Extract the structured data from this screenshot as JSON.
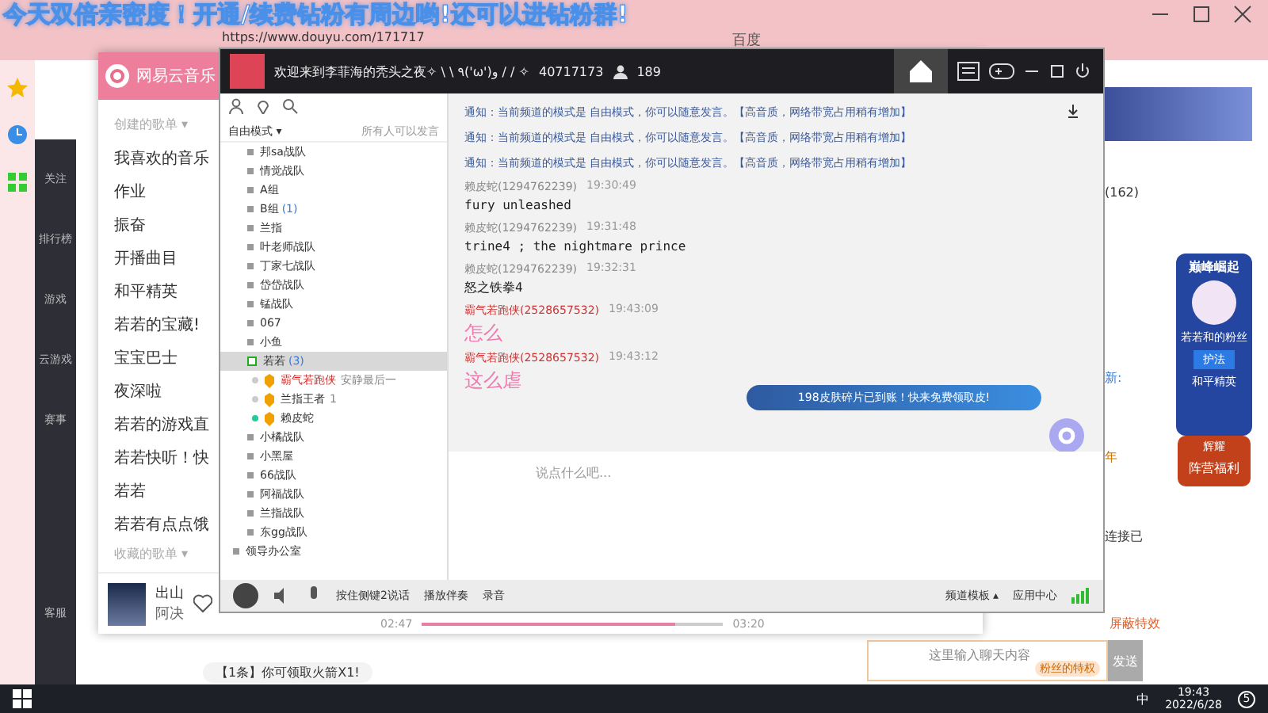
{
  "overlay_banner": "今天双倍亲密度！开通/续费钻粉有周边哟!还可以进钻粉群!",
  "browser": {
    "address": "https://www.douyu.com/171717",
    "bookmark": "百度"
  },
  "site_nav": [
    {
      "label": "关注"
    },
    {
      "label": "排行榜"
    },
    {
      "label": "游戏"
    },
    {
      "label": "云游戏"
    },
    {
      "label": "赛事"
    }
  ],
  "site_service": "客服",
  "music": {
    "title": "网易云音乐",
    "created_header": "创建的歌单 ▾",
    "playlists": [
      "我喜欢的音乐",
      "作业",
      "振奋",
      "开播曲目",
      "和平精英",
      "若若的宝藏!",
      "宝宝巴士",
      "夜深啦",
      "若若的游戏直",
      "若若快听！快",
      "若若",
      "若若有点点饿"
    ],
    "collected_header": "收藏的歌单 ▾",
    "song": "出山",
    "artist": "阿决",
    "elapsed": "02:47",
    "total": "03:20",
    "progress": {
      "level": 0.84
    }
  },
  "yy": {
    "title": "欢迎来到李菲海的秃头之夜✧ \\ \\ ٩('ω')و / / ✧",
    "channel_id": "40717173",
    "online": "189",
    "mode": "自由模式 ▾",
    "mode_hint": "所有人可以发言",
    "tree": [
      {
        "kind": "channel",
        "label": "邦sa战队",
        "selected": false
      },
      {
        "kind": "channel",
        "label": "情觉战队",
        "selected": false
      },
      {
        "kind": "channel",
        "label": "A组",
        "selected": false
      },
      {
        "kind": "channel",
        "label": "B组",
        "count": "(1)",
        "selected": false
      },
      {
        "kind": "channel",
        "label": "兰指",
        "selected": false
      },
      {
        "kind": "channel",
        "label": "叶老师战队",
        "selected": false
      },
      {
        "kind": "channel",
        "label": "丁家七战队",
        "selected": false
      },
      {
        "kind": "channel",
        "label": "岱岱战队",
        "selected": false
      },
      {
        "kind": "channel",
        "label": "锰战队",
        "selected": false
      },
      {
        "kind": "channel",
        "label": "067",
        "selected": false
      },
      {
        "kind": "channel",
        "label": "小鱼",
        "selected": false
      },
      {
        "kind": "channel",
        "label": "若若",
        "count": "(3)",
        "selected": true,
        "children": [
          {
            "kind": "member",
            "label": "霸气若跑侠",
            "note": "安静最后一",
            "color": "#d0312d",
            "active": false
          },
          {
            "kind": "member",
            "label": "兰指王者",
            "note": "1",
            "color": "#333333",
            "active": false
          },
          {
            "kind": "member",
            "label": "赖皮蛇",
            "color": "#333333",
            "active": true
          }
        ]
      },
      {
        "kind": "channel",
        "label": "小橘战队",
        "selected": false
      },
      {
        "kind": "channel",
        "label": "小黑屋",
        "selected": false
      },
      {
        "kind": "channel",
        "label": "66战队",
        "selected": false
      },
      {
        "kind": "channel",
        "label": "阿福战队",
        "selected": false
      },
      {
        "kind": "channel",
        "label": "兰指战队",
        "selected": false
      },
      {
        "kind": "channel",
        "label": "东gg战队",
        "selected": false
      }
    ],
    "root_channel": "领导办公室",
    "chat": [
      {
        "kind": "notice",
        "text": "通知：当前频道的模式是 自由模式，你可以随意发言。【高音质，网络带宽占用稍有增加】"
      },
      {
        "kind": "notice",
        "text": "通知：当前频道的模式是 自由模式，你可以随意发言。【高音质，网络带宽占用稍有增加】"
      },
      {
        "kind": "notice",
        "text": "通知：当前频道的模式是 自由模式，你可以随意发言。【高音质，网络带宽占用稍有增加】"
      },
      {
        "kind": "message",
        "user": "赖皮蛇(1294762239)",
        "time": "19:30:49",
        "text": "fury unleashed",
        "vip": false
      },
      {
        "kind": "message",
        "user": "赖皮蛇(1294762239)",
        "time": "19:31:48",
        "text": "trine4 ; the nightmare prince",
        "vip": false
      },
      {
        "kind": "message",
        "user": "赖皮蛇(1294762239)",
        "time": "19:32:31",
        "text": "怒之铁拳4",
        "vip": false
      },
      {
        "kind": "message",
        "user": "霸气若跑侠(2528657532)",
        "time": "19:43:09",
        "text": "怎么",
        "vip": true
      },
      {
        "kind": "message",
        "user": "霸气若跑侠(2528657532)",
        "time": "19:43:12",
        "text": "这么虐",
        "vip": true
      }
    ],
    "promo": "198皮肤碎片已到账！快来免费领取皮!",
    "input_placeholder": "说点什么吧...",
    "bottom": [
      "按住侧键2说话",
      "播放伴奏",
      "录音"
    ],
    "template": "频道模板 ▴",
    "app_center": "应用中心"
  },
  "site_right": {
    "fans": "(162)",
    "year": "年",
    "news": "新:",
    "connected": "连接已",
    "block_effects": "屏蔽特效",
    "chat_placeholder": "这里输入聊天内容",
    "send": "发送",
    "fan_badge": "粉丝的特权",
    "gift_notice": "【1条】你可领取火箭X1!"
  },
  "side_banner": {
    "title": "巅峰崛起",
    "name": "若若和的粉丝",
    "tag": "护法",
    "game": "和平精英",
    "top": "辉耀",
    "bottom": "阵营福利"
  },
  "taskbar": {
    "ime": "中",
    "time": "19:43",
    "date": "2022/6/28",
    "notifications": "5"
  }
}
